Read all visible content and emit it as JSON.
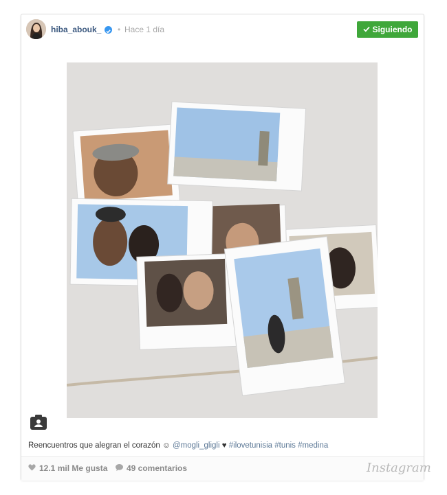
{
  "post": {
    "username": "hiba_abouk_",
    "separator": "•",
    "time_ago": "Hace 1 día",
    "follow_label": "Siguiendo",
    "caption": {
      "text": "Reencuentros que alegran el corazón",
      "emoji": "☺",
      "mention": "@mogli_gligli",
      "heart": "♥",
      "hashtags": "#ilovetunisia #tunis #medina"
    },
    "likes": "12.1 mil Me gusta",
    "comments": "49 comentarios",
    "brand": "Instagram"
  },
  "icons": {
    "verified": "verified-badge-icon",
    "check": "check-icon",
    "camera": "user-photo-tag-icon",
    "heart": "heart-icon",
    "comment": "comment-bubble-icon"
  },
  "colors": {
    "follow_button": "#3fa73a",
    "username": "#3d5a80",
    "verified": "#3897f0",
    "link": "#5c7896"
  }
}
